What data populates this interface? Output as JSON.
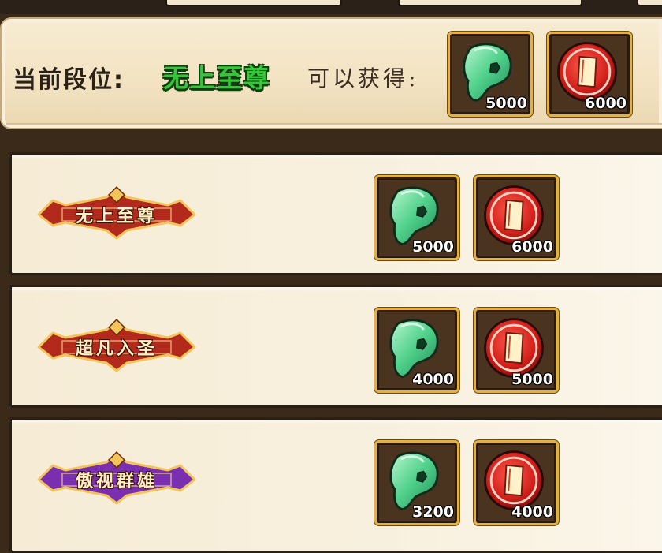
{
  "header": {
    "current_rank_label": "当前段位:",
    "current_rank": "无上至尊",
    "obtain_label": "可以获得:",
    "rewards": [
      {
        "icon": "jade-icon",
        "qty": "5000"
      },
      {
        "icon": "token-icon",
        "qty": "6000"
      }
    ]
  },
  "tiers": [
    {
      "name": "无上至尊",
      "badge_color": "#b22a1c",
      "rewards": [
        {
          "icon": "jade-icon",
          "qty": "5000"
        },
        {
          "icon": "token-icon",
          "qty": "6000"
        }
      ]
    },
    {
      "name": "超凡入圣",
      "badge_color": "#b22a1c",
      "rewards": [
        {
          "icon": "jade-icon",
          "qty": "4000"
        },
        {
          "icon": "token-icon",
          "qty": "5000"
        }
      ]
    },
    {
      "name": "傲视群雄",
      "badge_color": "#7a2fb0",
      "rewards": [
        {
          "icon": "jade-icon",
          "qty": "3200"
        },
        {
          "icon": "token-icon",
          "qty": "4000"
        }
      ]
    }
  ],
  "colors": {
    "rank_green": "#36c639",
    "slot_border": "#e6b03a",
    "panel_bg": "#f7ecd2"
  }
}
